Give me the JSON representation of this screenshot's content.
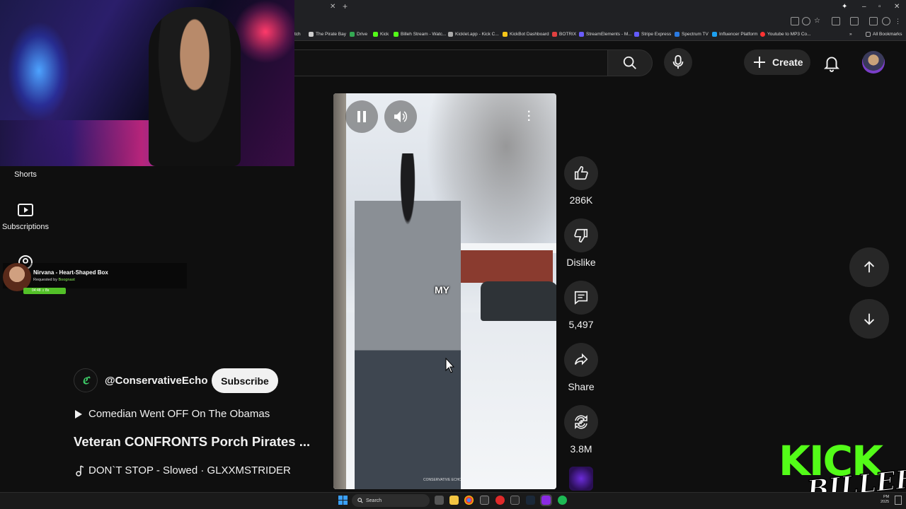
{
  "browser": {
    "bookmarks": [
      {
        "label": "tch",
        "color": "#888888"
      },
      {
        "label": "The Pirate Bay",
        "color": "#cccccc"
      },
      {
        "label": "Drive",
        "color": "#34a853"
      },
      {
        "label": "Kick",
        "color": "#53fc18"
      },
      {
        "label": "Billeh Stream - Watc...",
        "color": "#53fc18"
      },
      {
        "label": "Kicklet.app - Kick C...",
        "color": "#aaaaaa"
      },
      {
        "label": "KickBot Dashboard",
        "color": "#f5c518"
      },
      {
        "label": "BOTRIX",
        "color": "#e04040"
      },
      {
        "label": "StreamElements - M...",
        "color": "#6a5cff"
      },
      {
        "label": "Stripe Express",
        "color": "#635bff"
      },
      {
        "label": "Spectrum TV",
        "color": "#2a7ae2"
      },
      {
        "label": "Influencer Platform",
        "color": "#1da1f2"
      },
      {
        "label": "Youtube to MP3 Co...",
        "color": "#ff3333"
      },
      {
        "label": "All Bookmarks",
        "color": "#aaaaaa"
      }
    ]
  },
  "header": {
    "create_label": "Create"
  },
  "sidebar": {
    "items": [
      {
        "label": "Shorts"
      },
      {
        "label": "Subscriptions"
      }
    ]
  },
  "song_overlay": {
    "title": "Nirvana - Heart-Shaped Box",
    "requested_prefix": "Requested by",
    "requested_by": "Boognast",
    "time": "04:48 ♫ 8s"
  },
  "short": {
    "channel_handle": "@ConservativeEcho",
    "subscribe_label": "Subscribe",
    "playlist_label": "Comedian Went OFF On The Obamas",
    "title": "Veteran CONFRONTS Porch Pirates ...",
    "music": "DON`T STOP - Slowed · GLXXMSTRIDER",
    "caption": "MY",
    "watermark": "CONSERVATIVE ECHO"
  },
  "actions": {
    "like_count": "286K",
    "dislike_label": "Dislike",
    "comment_count": "5,497",
    "share_label": "Share",
    "remix_count": "3.8M"
  },
  "overlay_logo": {
    "kick": "KICK",
    "name": "BILLEH"
  },
  "taskbar": {
    "search_placeholder": "Search",
    "time": "PM",
    "date": "2025"
  },
  "colors": {
    "background": "#0f0f0f",
    "kick_green": "#53fc18",
    "button_bg": "#272727"
  }
}
